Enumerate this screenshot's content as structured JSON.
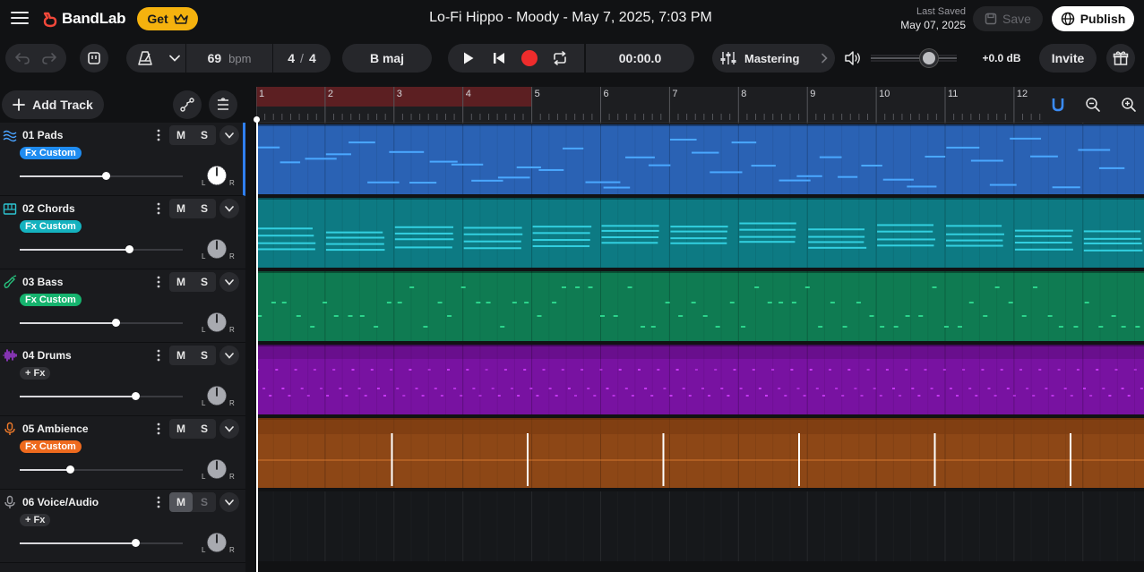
{
  "app": {
    "brand": "BandLab",
    "get_label": "Get",
    "project_title": "Lo-Fi Hippo - Moody - May 7, 2025, 7:03 PM",
    "last_saved_label": "Last Saved",
    "last_saved_date": "May 07, 2025",
    "save_label": "Save",
    "publish_label": "Publish"
  },
  "transport": {
    "bpm": "69",
    "bpm_unit": "bpm",
    "time_sig_num": "4",
    "time_sig_sep": "/",
    "time_sig_den": "4",
    "key": "B maj",
    "time": "00:00.0",
    "mastering_label": "Mastering",
    "master_volume_db": "+0.0 dB",
    "master_volume_level": 0.68,
    "invite_label": "Invite"
  },
  "toolbar": {
    "add_track_label": "Add Track"
  },
  "ruler": {
    "bars": [
      "1",
      "2",
      "3",
      "4",
      "5",
      "6",
      "7",
      "8",
      "9",
      "10",
      "11",
      "12"
    ],
    "loop_start_bar": 1,
    "loop_end_bar": 5
  },
  "tracks": [
    {
      "name": "01  Pads",
      "fx": "Fx Custom",
      "fx_color": "#1f8cf0",
      "color": "#2a6cc0",
      "icon": "pads-icon",
      "volume": 0.53,
      "muted": false,
      "solo": false
    },
    {
      "name": "02  Chords",
      "fx": "Fx Custom",
      "fx_color": "#15b2bf",
      "color": "#0f7c84",
      "icon": "keyboard-icon",
      "volume": 0.67,
      "muted": false,
      "solo": false
    },
    {
      "name": "03  Bass",
      "fx": "Fx Custom",
      "fx_color": "#16b36e",
      "color": "#0f7a4f",
      "icon": "guitar-icon",
      "volume": 0.59,
      "muted": false,
      "solo": false
    },
    {
      "name": "04  Drums",
      "fx": "+ Fx",
      "fx_color": "#303135",
      "color": "#7b14a3",
      "icon": "waveform-icon",
      "volume": 0.71,
      "muted": false,
      "solo": false
    },
    {
      "name": "05  Ambience",
      "fx": "Fx Custom",
      "fx_color": "#ee6a1e",
      "color": "#a2541a",
      "icon": "microphone-icon",
      "volume": 0.31,
      "muted": false,
      "solo": false
    },
    {
      "name": "06  Voice/Audio",
      "fx": "+ Fx",
      "fx_color": "#303135",
      "color": "#1a1c1f",
      "icon": "microphone-icon",
      "volume": 0.71,
      "muted": true,
      "solo": false
    }
  ],
  "ms": {
    "mute": "M",
    "solo": "S"
  },
  "pan_labels": {
    "left": "L",
    "right": "R"
  }
}
